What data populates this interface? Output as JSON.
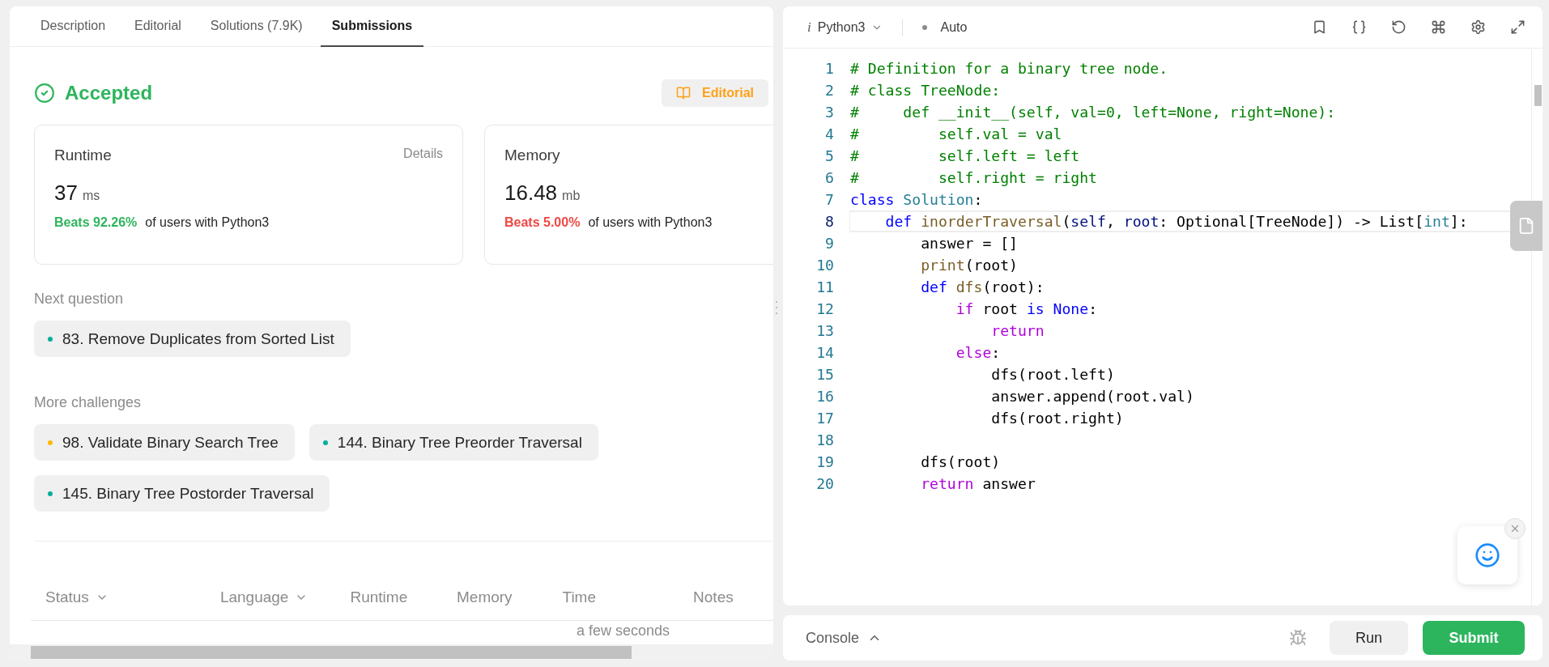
{
  "tabs": [
    {
      "label": "Description",
      "selected": false
    },
    {
      "label": "Editorial",
      "selected": false
    },
    {
      "label": "Solutions (7.9K)",
      "selected": false
    },
    {
      "label": "Submissions",
      "selected": true
    }
  ],
  "result": {
    "status": "Accepted",
    "editorial_button": "Editorial"
  },
  "stats": [
    {
      "title": "Runtime",
      "link": "Details",
      "value": "37",
      "unit": "ms",
      "beats": "Beats 92.26%",
      "good": true,
      "suffix": "of users with Python3"
    },
    {
      "title": "Memory",
      "value": "16.48",
      "unit": "mb",
      "beats": "Beats 5.00%",
      "good": false,
      "suffix": "of users with Python3"
    }
  ],
  "next_question": {
    "heading": "Next question",
    "items": [
      {
        "label": "83. Remove Duplicates from Sorted List",
        "color": "#00af9b"
      }
    ]
  },
  "more_challenges": {
    "heading": "More challenges",
    "items": [
      {
        "label": "98. Validate Binary Search Tree",
        "color": "#ffb800"
      },
      {
        "label": "144. Binary Tree Preorder Traversal",
        "color": "#00af9b"
      },
      {
        "label": "145. Binary Tree Postorder Traversal",
        "color": "#00af9b"
      }
    ]
  },
  "table": {
    "columns": [
      {
        "label": "Status",
        "sortable": true
      },
      {
        "label": "Language",
        "sortable": true
      },
      {
        "label": "Runtime",
        "sortable": false
      },
      {
        "label": "Memory",
        "sortable": false
      },
      {
        "label": "Time",
        "sortable": false
      },
      {
        "label": "Notes",
        "sortable": false
      }
    ],
    "rows": [
      {
        "time": "a few seconds"
      }
    ]
  },
  "editor": {
    "lang_icon": "i",
    "language": "Python3",
    "mode": "Auto",
    "lines": [
      {
        "n": "1",
        "selected": false,
        "tokens": [
          {
            "t": "# Definition for a binary tree node.",
            "kind": "comment"
          }
        ]
      },
      {
        "n": "2",
        "selected": false,
        "tokens": [
          {
            "t": "# class TreeNode:",
            "kind": "comment"
          }
        ]
      },
      {
        "n": "3",
        "selected": false,
        "tokens": [
          {
            "t": "#     def __init__(self, val=0, left=None, right=None):",
            "kind": "comment"
          }
        ]
      },
      {
        "n": "4",
        "selected": false,
        "tokens": [
          {
            "t": "#         self.val = val",
            "kind": "comment"
          }
        ]
      },
      {
        "n": "5",
        "selected": false,
        "tokens": [
          {
            "t": "#         self.left = left",
            "kind": "comment"
          }
        ]
      },
      {
        "n": "6",
        "selected": false,
        "tokens": [
          {
            "t": "#         self.right = right",
            "kind": "comment"
          }
        ]
      },
      {
        "n": "7",
        "selected": false,
        "tokens": [
          {
            "t": "class",
            "kind": "keyword"
          },
          {
            "t": " Solution",
            "kind": "type"
          },
          {
            "t": ":",
            "kind": "plain"
          }
        ]
      },
      {
        "n": "8",
        "selected": true,
        "tokens": [
          {
            "t": "    def",
            "kind": "keyword"
          },
          {
            "t": " inorderTraversal",
            "kind": "function"
          },
          {
            "t": "(",
            "kind": "plain"
          },
          {
            "t": "self",
            "kind": "param"
          },
          {
            "t": ", ",
            "kind": "plain"
          },
          {
            "t": "root",
            "kind": "param"
          },
          {
            "t": ": Optional[TreeNode]) -> List[",
            "kind": "plain"
          },
          {
            "t": "int",
            "kind": "type"
          },
          {
            "t": "]:",
            "kind": "plain"
          }
        ]
      },
      {
        "n": "9",
        "selected": false,
        "tokens": [
          {
            "t": "        answer = []",
            "kind": "plain"
          }
        ]
      },
      {
        "n": "10",
        "selected": false,
        "tokens": [
          {
            "t": "        print",
            "kind": "function"
          },
          {
            "t": "(root)",
            "kind": "plain"
          }
        ]
      },
      {
        "n": "11",
        "selected": false,
        "tokens": [
          {
            "t": "        def",
            "kind": "keyword"
          },
          {
            "t": " dfs",
            "kind": "function"
          },
          {
            "t": "(root):",
            "kind": "plain"
          }
        ]
      },
      {
        "n": "12",
        "selected": false,
        "tokens": [
          {
            "t": "            if",
            "kind": "control"
          },
          {
            "t": " root ",
            "kind": "plain"
          },
          {
            "t": "is",
            "kind": "keyword"
          },
          {
            "t": " None",
            "kind": "keyword"
          },
          {
            "t": ":",
            "kind": "plain"
          }
        ]
      },
      {
        "n": "13",
        "selected": false,
        "tokens": [
          {
            "t": "                return",
            "kind": "control"
          }
        ]
      },
      {
        "n": "14",
        "selected": false,
        "tokens": [
          {
            "t": "            else",
            "kind": "control"
          },
          {
            "t": ":",
            "kind": "plain"
          }
        ]
      },
      {
        "n": "15",
        "selected": false,
        "tokens": [
          {
            "t": "                dfs(root.left)",
            "kind": "plain"
          }
        ]
      },
      {
        "n": "16",
        "selected": false,
        "tokens": [
          {
            "t": "                answer.append(root.val)",
            "kind": "plain"
          }
        ]
      },
      {
        "n": "17",
        "selected": false,
        "tokens": [
          {
            "t": "                dfs(root.right)",
            "kind": "plain"
          }
        ]
      },
      {
        "n": "18",
        "selected": false
      },
      {
        "n": "19",
        "selected": false,
        "tokens": [
          {
            "t": "        dfs(root)",
            "kind": "plain"
          }
        ]
      },
      {
        "n": "20",
        "selected": false,
        "tokens": [
          {
            "t": "        return",
            "kind": "control"
          },
          {
            "t": " answer",
            "kind": "plain"
          }
        ]
      }
    ]
  },
  "console": {
    "label": "Console",
    "run": "Run",
    "submit": "Submit"
  }
}
